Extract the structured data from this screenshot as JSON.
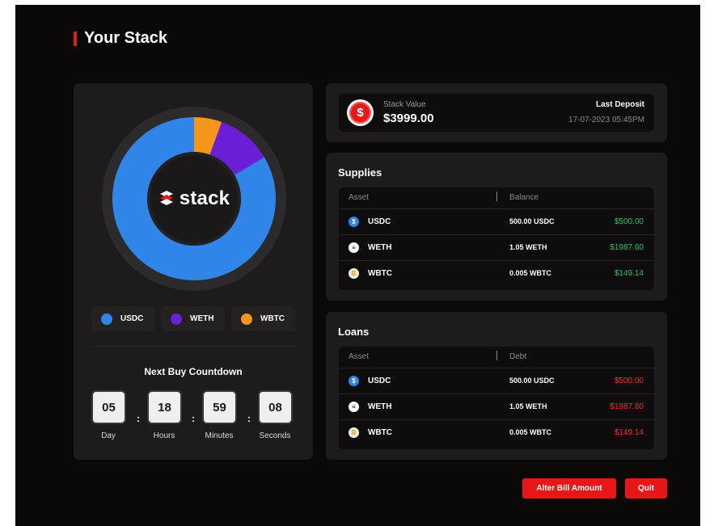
{
  "page": {
    "title": "Your Stack"
  },
  "colors": {
    "usdc": "#2f86e8",
    "weth": "#6a1fd6",
    "wbtc": "#f5951c",
    "accent": "#e61b1b"
  },
  "logo": {
    "text": "stack"
  },
  "allocation": [
    {
      "asset": "USDC",
      "share_pct": 83.5
    },
    {
      "asset": "WETH",
      "share_pct": 11.0
    },
    {
      "asset": "WBTC",
      "share_pct": 5.5
    }
  ],
  "legend": [
    {
      "label": "USDC",
      "color": "#2f86e8"
    },
    {
      "label": "WETH",
      "color": "#6a1fd6"
    },
    {
      "label": "WBTC",
      "color": "#f5951c"
    }
  ],
  "countdown": {
    "title": "Next Buy Countdown",
    "units": [
      {
        "value": "05",
        "label": "Day"
      },
      {
        "value": "18",
        "label": "Hours"
      },
      {
        "value": "59",
        "label": "Minutes"
      },
      {
        "value": "08",
        "label": "Seconds"
      }
    ],
    "separator": ":"
  },
  "stack_value": {
    "icon": "dollar-icon",
    "label": "Stack Value",
    "value": "$3999.00",
    "last_deposit_label": "Last Deposit",
    "last_deposit_value": "17-07-2023 05:45PM"
  },
  "supplies": {
    "title": "Supplies",
    "col_asset": "Asset",
    "col_value": "Balance",
    "rows": [
      {
        "asset": "USDC",
        "icon": "usdc-icon",
        "amount": "500.00 USDC",
        "usd": "$500.00"
      },
      {
        "asset": "WETH",
        "icon": "weth-icon",
        "amount": "1.05 WETH",
        "usd": "$1987.60"
      },
      {
        "asset": "WBTC",
        "icon": "wbtc-icon",
        "amount": "0.005 WBTC",
        "usd": "$149.14"
      }
    ]
  },
  "loans": {
    "title": "Loans",
    "col_asset": "Asset",
    "col_value": "Debt",
    "rows": [
      {
        "asset": "USDC",
        "icon": "usdc-icon",
        "amount": "500.00 USDC",
        "usd": "$500.00"
      },
      {
        "asset": "WETH",
        "icon": "weth-icon",
        "amount": "1.05 WETH",
        "usd": "$1987.60"
      },
      {
        "asset": "WBTC",
        "icon": "wbtc-icon",
        "amount": "0.005 WBTC",
        "usd": "$149.14"
      }
    ]
  },
  "actions": {
    "alter_label": "Alter Bill Amount",
    "quit_label": "Quit"
  }
}
